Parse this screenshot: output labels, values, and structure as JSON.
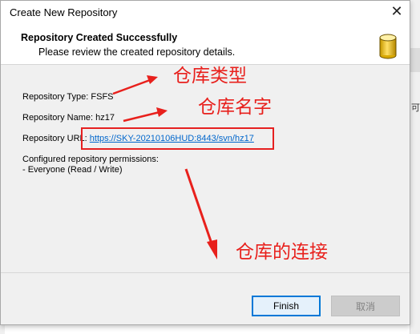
{
  "window": {
    "title": "Create New Repository",
    "close_glyph": "✕"
  },
  "header": {
    "title": "Repository Created Successfully",
    "subtitle": "Please review the created repository details.",
    "icon": "database-icon"
  },
  "details": {
    "type_label": "Repository Type: FSFS",
    "name_label": "Repository Name: hz17",
    "url_label": "Repository URL:",
    "url_value": "https://SKY-20210106HUD:8443/svn/hz17",
    "permissions_label": "Configured repository permissions:",
    "permissions_value": "- Everyone (Read / Write)"
  },
  "annotations": {
    "type_note": "仓库类型",
    "name_note": "仓库名字",
    "url_note": "仓库的连接",
    "color": "#e8201c"
  },
  "buttons": {
    "finish": "Finish",
    "cancel": "取消"
  },
  "background": {
    "right_text": "可项"
  }
}
